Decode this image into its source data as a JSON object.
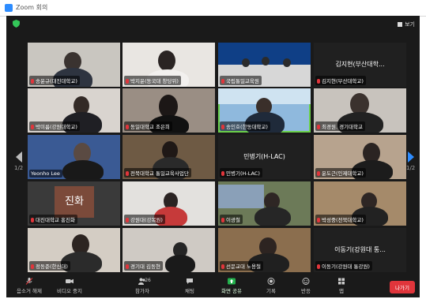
{
  "window": {
    "title": "Zoom 회의"
  },
  "view_button": "보기",
  "pager": {
    "left": "1/2",
    "right": "1/2"
  },
  "tiles": [
    {
      "label": "송윤규(대진대학교)",
      "show": "video",
      "speaking": false
    },
    {
      "label": "박지윤(동국대 창당위)",
      "show": "video",
      "speaking": false
    },
    {
      "label": "국립통일교육원",
      "show": "video",
      "speaking": false
    },
    {
      "name": "김지현(부산대학...",
      "label": "김지현(부산대학교)",
      "show": "name",
      "speaking": false
    },
    {
      "label": "박미름(강원대학교)",
      "show": "video",
      "speaking": false
    },
    {
      "label": "동일대학교 조은희",
      "show": "video",
      "speaking": false
    },
    {
      "label": "송인호(한동대학교)",
      "show": "video",
      "speaking": true
    },
    {
      "label": "최경원. 경기대학교",
      "show": "video",
      "speaking": false
    },
    {
      "label": "Yeonho Lee",
      "show": "video",
      "speaking": false
    },
    {
      "label": "전북대학교 통일교육사업단",
      "show": "video",
      "speaking": false
    },
    {
      "name": "민병기(H-LAC)",
      "label": "민병기(H-LAC)",
      "show": "name",
      "speaking": false
    },
    {
      "label": "윤도근(인제대학교)",
      "show": "video",
      "speaking": false
    },
    {
      "card": "진화",
      "label": "대진대학교 홍진화",
      "show": "card",
      "speaking": false
    },
    {
      "label": "강원대(강복원)",
      "show": "video",
      "speaking": false
    },
    {
      "label": "이광철",
      "show": "video",
      "speaking": false
    },
    {
      "label": "박성중(전북대학교)",
      "show": "video",
      "speaking": false
    },
    {
      "label": "정동준(한신대)",
      "show": "video",
      "speaking": false
    },
    {
      "label": "경기대 김동현",
      "show": "video",
      "speaking": false
    },
    {
      "label": "선문교대 노용철",
      "show": "video",
      "speaking": false
    },
    {
      "name": "이동기(강원대 통...",
      "label": "이동기(강원대 통강원)",
      "show": "name",
      "speaking": false
    }
  ],
  "toolbar": {
    "mute": "음소거 해제",
    "video": "비디오 중지",
    "participants": "참가자",
    "participants_count": "26",
    "chat": "채팅",
    "share": "화면 공유",
    "record": "기록",
    "reactions": "반응",
    "apps": "앱",
    "leave": "나가기"
  },
  "colors": {
    "speaking": "#6bd14a",
    "leave": "#e0353b",
    "share": "#22b14c"
  }
}
